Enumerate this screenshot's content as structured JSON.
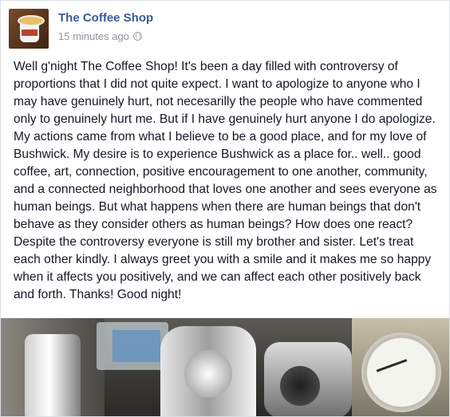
{
  "post": {
    "page_name": "The Coffee Shop",
    "timestamp": "15 minutes ago",
    "privacy_icon": "globe-icon",
    "text": "Well g'night The Coffee Shop! It's been a day filled with controversy of proportions that I did not quite expect. I want to apologize to anyone who I may have genuinely hurt, not necesarilly the people who have commented only to genuinely hurt me. But if I have genuinely hurt anyone I do apologize. My actions came from what I believe to be a good place, and for my love of Bushwick. My desire is to experience Bushwick as a place for.. well.. good coffee, art, connection, positive encouragement to one another, community, and a connected neighborhood that loves one another and sees everyone as human beings. But what happens when there are human beings that don't behave as they consider others as human beings? How does one react? Despite the controversy everyone is still my brother and sister. Let's treat each other kindly. I always greet you with a smile and it makes me so happy when it affects you positively, and we can affect each other positively back and forth. Thanks! Good night!"
  },
  "colors": {
    "page_name": "#3b5998",
    "meta": "#90949c",
    "text": "#141823"
  }
}
